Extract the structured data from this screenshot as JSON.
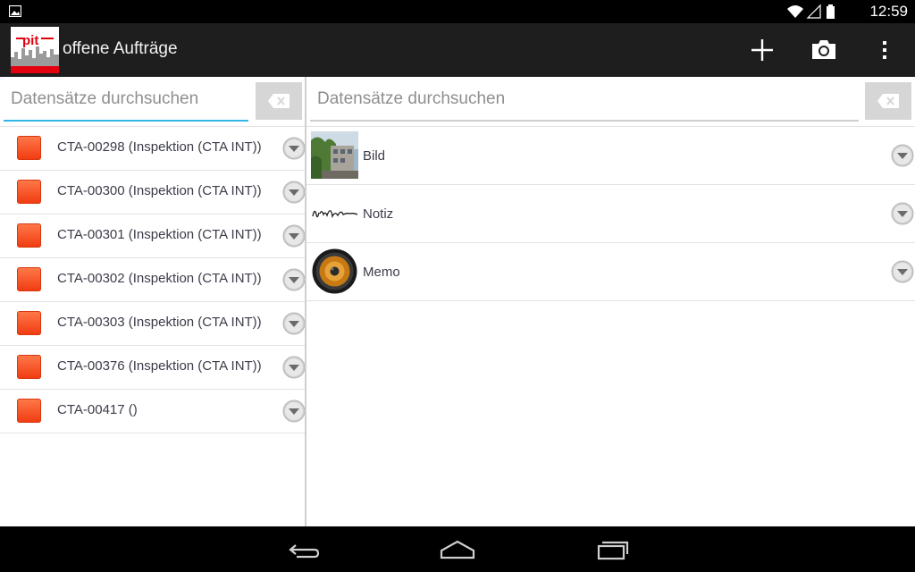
{
  "status_bar": {
    "time": "12:59",
    "left_icons": [
      "gallery-notification-icon"
    ],
    "right_icons": [
      "wifi-icon",
      "no-sim-signal-icon",
      "battery-icon"
    ]
  },
  "action_bar": {
    "title": "offene Aufträge",
    "logo_text": "pit",
    "actions": [
      "add-icon",
      "camera-icon",
      "overflow-menu-icon"
    ]
  },
  "left_pane": {
    "search": {
      "placeholder": "Datensätze durchsuchen",
      "value": ""
    },
    "items": [
      {
        "label": "CTA-00298 (Inspektion (CTA INT))"
      },
      {
        "label": "CTA-00300 (Inspektion (CTA INT))"
      },
      {
        "label": "CTA-00301 (Inspektion (CTA INT))"
      },
      {
        "label": "CTA-00302 (Inspektion (CTA INT))"
      },
      {
        "label": "CTA-00303 (Inspektion (CTA INT))"
      },
      {
        "label": "CTA-00376 (Inspektion (CTA INT))"
      },
      {
        "label": "CTA-00417 ()"
      }
    ]
  },
  "right_pane": {
    "search": {
      "placeholder": "Datensätze durchsuchen",
      "value": ""
    },
    "items": [
      {
        "label": "Bild",
        "icon": "photo-thumbnail"
      },
      {
        "label": "Notiz",
        "icon": "signature-icon"
      },
      {
        "label": "Memo",
        "icon": "speaker-icon"
      }
    ]
  },
  "nav_bar": {
    "buttons": [
      "back-icon",
      "home-icon",
      "recent-apps-icon"
    ]
  },
  "colors": {
    "action_bar_bg": "#1e1e1e",
    "search_focus_line": "#33b5e5",
    "order_icon": "#f24a1c",
    "logo_red": "#e3000f"
  }
}
